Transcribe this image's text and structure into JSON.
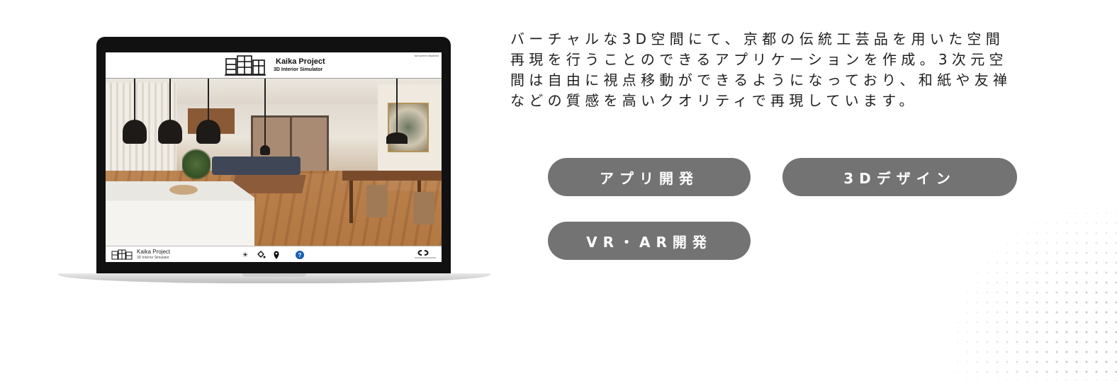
{
  "laptop_screen": {
    "header": {
      "title": "Kaika Project",
      "subtitle": "3D Interior Simulator",
      "fullscreen_note": "full screen disabled"
    },
    "footer": {
      "title": "Kaika Project",
      "subtitle": "3D Interior Simulator",
      "tools": [
        "sun-icon",
        "paint-bucket-icon",
        "location-pin-icon"
      ],
      "help_label": "?",
      "help_color": "#1a5fb4"
    }
  },
  "description": {
    "lines": [
      "バーチャルな3D空間にて、京都の伝統工芸品を用いた空間",
      "再現を行うことのできるアプリケーションを作成。3次元空",
      "間は自由に視点移動ができるようになっており、和紙や友禅",
      "などの質感を高いクオリティで再現しています。"
    ]
  },
  "tags": {
    "app_dev": "アプリ開発",
    "design_3d": "3Dデザイン",
    "vr_ar_dev": "VR・AR開発",
    "pill_color": "#737373"
  }
}
